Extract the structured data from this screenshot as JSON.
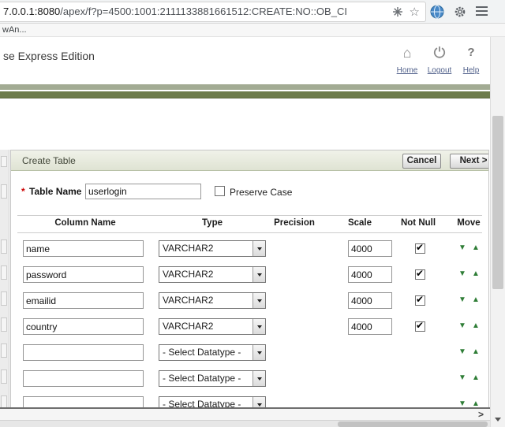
{
  "browser": {
    "url_host": "7.0.0.1:8080",
    "url_path": "/apex/f?p=4500:1001:2111133881661512:CREATE:NO::OB_CI",
    "bookmark_label": "wAn..."
  },
  "header": {
    "title": "se Express Edition",
    "home_label": "Home",
    "logout_label": "Logout",
    "help_label": "Help"
  },
  "region": {
    "title": "Create Table",
    "cancel_label": "Cancel",
    "next_label": "Next >",
    "table_name": {
      "required": "*",
      "label": "Table Name",
      "value": "userlogin",
      "preserve_case_label": "Preserve Case",
      "preserve_case_checked": false
    },
    "grid": {
      "headers": {
        "column_name": "Column Name",
        "type": "Type",
        "precision": "Precision",
        "scale": "Scale",
        "not_null": "Not Null",
        "move": "Move"
      },
      "rows": [
        {
          "name": "name",
          "type": "VARCHAR2",
          "precision": "",
          "scale": "4000",
          "not_null": true
        },
        {
          "name": "password",
          "type": "VARCHAR2",
          "precision": "",
          "scale": "4000",
          "not_null": true
        },
        {
          "name": "emailid",
          "type": "VARCHAR2",
          "precision": "",
          "scale": "4000",
          "not_null": true
        },
        {
          "name": "country",
          "type": "VARCHAR2",
          "precision": "",
          "scale": "4000",
          "not_null": true
        },
        {
          "name": "",
          "type": "- Select Datatype -",
          "precision": "",
          "scale": "",
          "not_null": false
        },
        {
          "name": "",
          "type": "- Select Datatype -",
          "precision": "",
          "scale": "",
          "not_null": false
        },
        {
          "name": "",
          "type": "- Select Datatype -",
          "precision": "",
          "scale": "",
          "not_null": false
        }
      ]
    }
  },
  "icons": {
    "home": "⌂",
    "help": "?",
    "star": "☆",
    "check": "✔",
    "move_down": "▼",
    "move_up": "▲",
    "h_scroll_arrow": ">"
  },
  "colors": {
    "bar_top": "#a2ab93",
    "bar_bottom": "#6d7c4b",
    "move_green": "#2e7d36",
    "required_red": "#cc0000"
  }
}
